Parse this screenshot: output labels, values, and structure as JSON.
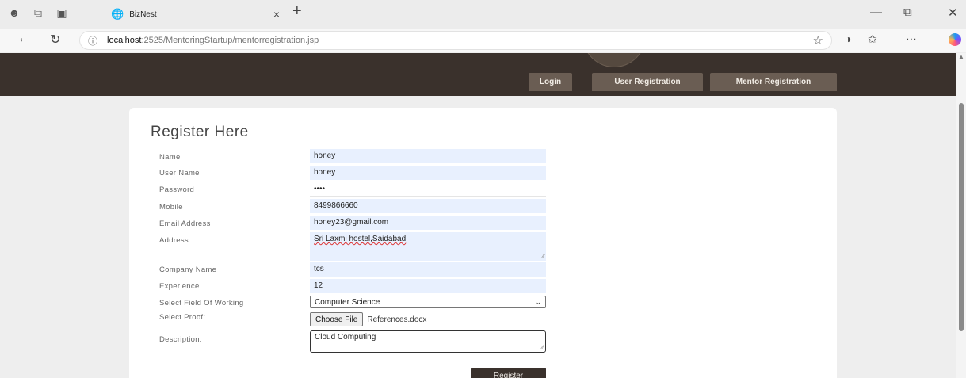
{
  "browser": {
    "tab_title": "BizNest",
    "url_host": "localhost",
    "url_path": ":2525/MentoringStartup/mentorregistration.jsp"
  },
  "header": {
    "nav": [
      "Login",
      "User Registration",
      "Mentor Registration"
    ]
  },
  "form": {
    "title": "Register Here",
    "labels": {
      "name": "Name",
      "username": "User Name",
      "password": "Password",
      "mobile": "Mobile",
      "email": "Email Address",
      "address": "Address",
      "company": "Company Name",
      "experience": "Experience",
      "field": "Select Field Of Working",
      "proof": "Select Proof:",
      "description": "Description:"
    },
    "values": {
      "name": "honey",
      "username": "honey",
      "password": "••••",
      "mobile": "8499866660",
      "email": "honey23@gmail.com",
      "address": "Sri Laxmi hostel,Saidabad",
      "company": "tcs",
      "experience": "12",
      "field": "Computer Science",
      "proof_button": "Choose File",
      "proof_file": "References.docx",
      "description": "Cloud Computing"
    },
    "submit": "Register"
  }
}
